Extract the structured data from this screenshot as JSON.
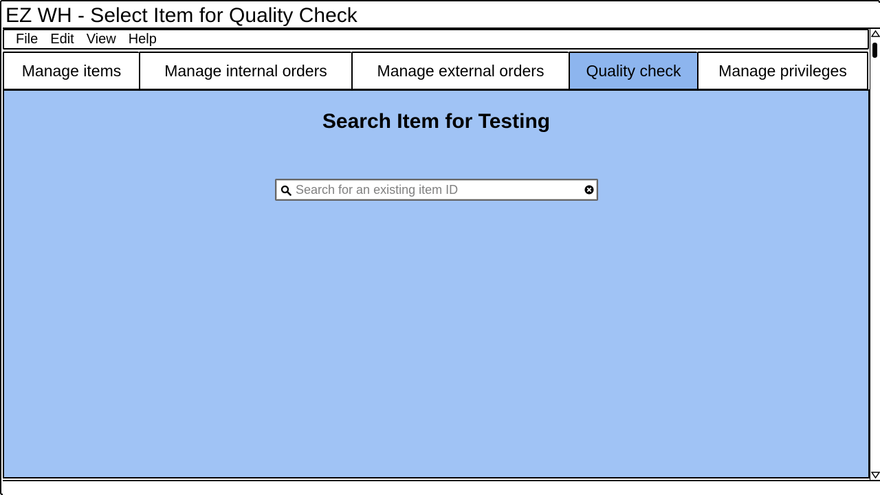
{
  "window": {
    "title": "EZ WH - Select Item for Quality Check"
  },
  "menu": {
    "items": [
      "File",
      "Edit",
      "View",
      "Help"
    ]
  },
  "tabs": [
    {
      "label": "Manage items",
      "active": false
    },
    {
      "label": "Manage internal orders",
      "active": false
    },
    {
      "label": "Manage external orders",
      "active": false
    },
    {
      "label": "Quality check",
      "active": true
    },
    {
      "label": "Manage privileges",
      "active": false
    }
  ],
  "main": {
    "title": "Search Item for Testing",
    "search": {
      "placeholder": "Search for an existing item ID",
      "value": ""
    }
  },
  "colors": {
    "content_bg": "#a0c3f5",
    "active_tab": "#8db5ee"
  },
  "icons": {
    "search": "search-icon",
    "clear": "clear-icon"
  }
}
